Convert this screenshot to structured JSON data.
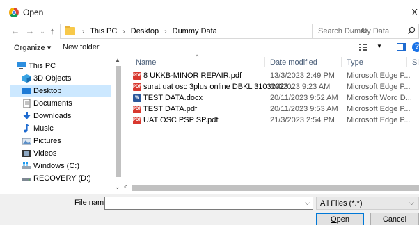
{
  "window": {
    "title": "Open",
    "close_glyph": "X"
  },
  "address": {
    "crumbs": [
      "This PC",
      "Desktop",
      "Dummy Data"
    ],
    "search_placeholder": "Search Dummy Data"
  },
  "toolbar": {
    "organize": "Organize ▾",
    "new_folder": "New folder",
    "help": "?"
  },
  "nav": {
    "items": [
      {
        "label": "This PC",
        "icon": "computer-icon"
      },
      {
        "label": "3D Objects",
        "icon": "3d-objects-icon"
      },
      {
        "label": "Desktop",
        "icon": "desktop-icon",
        "selected": true
      },
      {
        "label": "Documents",
        "icon": "documents-icon"
      },
      {
        "label": "Downloads",
        "icon": "downloads-icon"
      },
      {
        "label": "Music",
        "icon": "music-icon"
      },
      {
        "label": "Pictures",
        "icon": "pictures-icon"
      },
      {
        "label": "Videos",
        "icon": "videos-icon"
      },
      {
        "label": "Windows (C:)",
        "icon": "drive-c-icon"
      },
      {
        "label": "RECOVERY (D:)",
        "icon": "drive-d-icon"
      }
    ]
  },
  "files": {
    "columns": {
      "name": "Name",
      "date": "Date modified",
      "type": "Type",
      "size": "Size"
    },
    "rows": [
      {
        "name": "8 UKKB-MINOR REPAIR.pdf",
        "date": "13/3/2023 2:49 PM",
        "type": "Microsoft Edge P...",
        "icon": "pdf"
      },
      {
        "name": "surat uat osc 3plus online DBKL 31032023...",
        "date": "3/4/2023 9:23 AM",
        "type": "Microsoft Edge P...",
        "icon": "pdf"
      },
      {
        "name": "TEST DATA.docx",
        "date": "20/11/2023 9:52 AM",
        "type": "Microsoft Word D...",
        "icon": "docx"
      },
      {
        "name": "TEST DATA.pdf",
        "date": "20/11/2023 9:53 AM",
        "type": "Microsoft Edge P...",
        "icon": "pdf"
      },
      {
        "name": "UAT OSC PSP SP.pdf",
        "date": "21/3/2023 2:54 PM",
        "type": "Microsoft Edge P...",
        "icon": "pdf"
      }
    ]
  },
  "bottom": {
    "filename_label_pre": "File ",
    "filename_label_key": "n",
    "filename_label_post": "ame:",
    "filename_value": "",
    "filetype": "All Files (*.*)",
    "open_key": "O",
    "open_rest": "pen",
    "cancel": "Cancel"
  },
  "colors": {
    "selected": "#cce8ff",
    "accent": "#0078d7",
    "pdf": "#d8382f",
    "docx": "#2b579a"
  }
}
